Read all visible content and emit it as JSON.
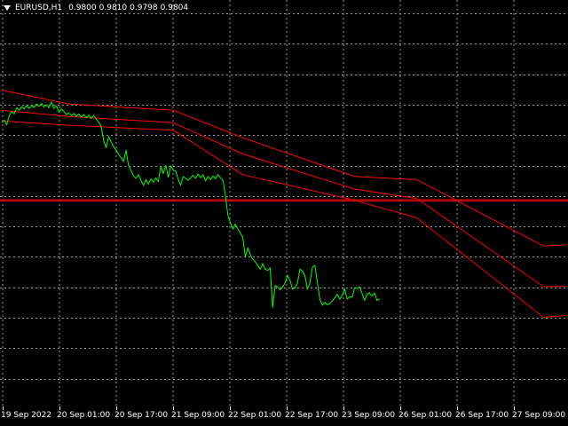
{
  "window": {
    "symbol_label": "EURUSD,H1",
    "ohlc": [
      "0.9800",
      "0.9810",
      "0.9798",
      "0.9804"
    ],
    "menu_icon": "triangle-down-icon"
  },
  "colors": {
    "background": "#000000",
    "grid": "#9a9a9a",
    "price_line": "#00ff00",
    "channel": "#ff0000",
    "text": "#ffffff"
  },
  "time_axis": {
    "labels": [
      "19 Sep 2022",
      "20 Sep 01:00",
      "20 Sep 17:00",
      "21 Sep 09:00",
      "22 Sep 01:00",
      "22 Sep 17:00",
      "23 Sep 09:00",
      "26 Sep 01:00",
      "26 Sep 17:00",
      "27 Sep 09:00"
    ]
  },
  "chart_data": {
    "type": "line",
    "grid": true,
    "series": [
      {
        "role": "price",
        "y": [
          0.9788,
          0.9792,
          0.9785,
          0.9799,
          0.9806,
          0.9802,
          0.9812,
          0.9808,
          0.9814,
          0.981,
          0.9815,
          0.9811,
          0.9816,
          0.9812,
          0.9818,
          0.9814,
          0.9819,
          0.9813,
          0.9817,
          0.9812,
          0.9821,
          0.9811,
          0.9815,
          0.9805,
          0.981,
          0.9806,
          0.9801,
          0.9804,
          0.9799,
          0.9803,
          0.9798,
          0.9802,
          0.9797,
          0.9801,
          0.9796,
          0.98,
          0.9795,
          0.9799,
          0.9794,
          0.9789,
          0.9782,
          0.976,
          0.9748,
          0.9766,
          0.9757,
          0.975,
          0.9744,
          0.9738,
          0.9732,
          0.9726,
          0.9744,
          0.972,
          0.9712,
          0.9703,
          0.9699,
          0.9705,
          0.9696,
          0.9688,
          0.9697,
          0.969,
          0.9698,
          0.9693,
          0.97,
          0.9694,
          0.9718,
          0.9707,
          0.972,
          0.9701,
          0.9719,
          0.9712,
          0.9711,
          0.9697,
          0.9688,
          0.9702,
          0.9699,
          0.9696,
          0.97,
          0.9704,
          0.9699,
          0.9706,
          0.97,
          0.9705,
          0.9695,
          0.9702,
          0.9697,
          0.9703,
          0.9698,
          0.9705,
          0.97,
          0.9696,
          0.9672,
          0.964,
          0.9628,
          0.9618,
          0.9626,
          0.9618,
          0.9612,
          0.9604,
          0.9574,
          0.9588,
          0.9577,
          0.957,
          0.9566,
          0.956,
          0.9554,
          0.9563,
          0.9554,
          0.9552,
          0.9556,
          0.9493,
          0.9528,
          0.9526,
          0.9521,
          0.9525,
          0.9532,
          0.9544,
          0.9536,
          0.9522,
          0.9524,
          0.9532,
          0.9554,
          0.9551,
          0.9543,
          0.9522,
          0.9532,
          0.9557,
          0.956,
          0.9533,
          0.9506,
          0.9496,
          0.9501,
          0.9497,
          0.9499,
          0.9503,
          0.9508,
          0.9514,
          0.9506,
          0.9512,
          0.9522,
          0.9506,
          0.951,
          0.9509,
          0.9524,
          0.9523,
          0.9526,
          0.9515,
          0.9504,
          0.9514,
          0.9516,
          0.9511,
          0.9516,
          0.9504,
          0.9506
        ]
      },
      {
        "role": "channel-upper",
        "x": [
          0,
          27,
          69,
          97,
          142,
          167,
          218,
          227
        ],
        "y": [
          0.984,
          0.9818,
          0.9808,
          0.9764,
          0.9702,
          0.9697,
          0.9591,
          0.9593
        ]
      },
      {
        "role": "channel-middle",
        "x": [
          0,
          27,
          69,
          97,
          142,
          167,
          218,
          227
        ],
        "y": [
          0.9808,
          0.9798,
          0.9788,
          0.9738,
          0.9682,
          0.9667,
          0.9526,
          0.9527
        ]
      },
      {
        "role": "channel-lower",
        "x": [
          0,
          27,
          69,
          97,
          142,
          167,
          218,
          227
        ],
        "y": [
          0.9791,
          0.9784,
          0.9776,
          0.9705,
          0.9664,
          0.9636,
          0.9477,
          0.948
        ]
      },
      {
        "role": "horizontal-level",
        "y": [
          0.9665
        ]
      },
      {
        "role": "horizontal-level",
        "y": [
          0.9663
        ]
      }
    ]
  }
}
